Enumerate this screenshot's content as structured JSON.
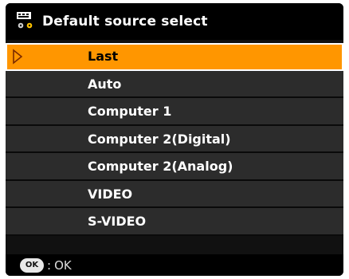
{
  "title": "Default source select",
  "menu_items": [
    {
      "label": "Last",
      "selected": true
    },
    {
      "label": "Auto"
    },
    {
      "label": "Computer 1"
    },
    {
      "label": "Computer 2(Digital)"
    },
    {
      "label": "Computer 2(Analog)"
    },
    {
      "label": "VIDEO"
    },
    {
      "label": "S-VIDEO"
    }
  ],
  "footer": {
    "ok_button": "OK",
    "separator": ":",
    "ok_label": "OK"
  },
  "colors": {
    "highlight": "#ff9600",
    "menu_bg": "#2c2c2c",
    "title_bg": "#000000"
  },
  "icons": {
    "title": "input-source-icon",
    "selection": "right-triangle-arrow-icon",
    "footer": "ok-button-icon"
  }
}
